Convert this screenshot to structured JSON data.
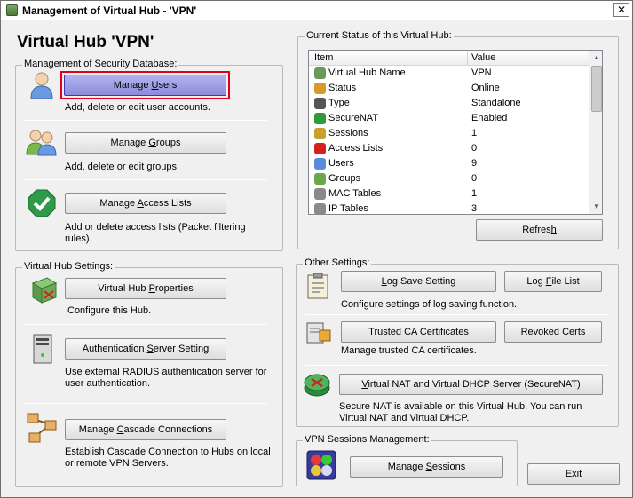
{
  "window": {
    "title": "Management of Virtual Hub - 'VPN'",
    "close_glyph": "✕"
  },
  "heading": "Virtual Hub 'VPN'",
  "security_db": {
    "legend": "Management of Security Database:",
    "manage_users": {
      "pre": "Manage ",
      "key": "U",
      "post": "sers",
      "desc": "Add, delete or edit user accounts.",
      "icon": "user-icon"
    },
    "manage_groups": {
      "pre": "Manage ",
      "key": "G",
      "post": "roups",
      "desc": "Add, delete or edit groups.",
      "icon": "group-icon"
    },
    "manage_access_lists": {
      "pre": "Manage ",
      "key": "A",
      "post": "ccess Lists",
      "desc": "Add or delete access lists (Packet filtering rules).",
      "icon": "checkmark-shield-icon"
    }
  },
  "hub_settings": {
    "legend": "Virtual Hub Settings:",
    "properties": {
      "pre": "Virtual Hub ",
      "key": "P",
      "post": "roperties",
      "desc": "Configure this Hub.",
      "icon": "hub-properties-icon"
    },
    "auth_server": {
      "pre": "Authentication ",
      "key": "S",
      "post": "erver Setting",
      "desc": "Use external RADIUS authentication server for user authentication.",
      "icon": "server-icon"
    },
    "cascade": {
      "pre": "Manage ",
      "key": "C",
      "post": "ascade Connections",
      "desc": "Establish Cascade Connection to Hubs on local or remote VPN Servers.",
      "icon": "cascade-network-icon"
    }
  },
  "status": {
    "legend": "Current Status of this Virtual Hub:",
    "columns": [
      "Item",
      "Value"
    ],
    "rows": [
      {
        "item": "Virtual Hub Name",
        "value": "VPN",
        "icon": "hub-icon",
        "color": "#6a9a5a"
      },
      {
        "item": "Status",
        "value": "Online",
        "icon": "status-icon",
        "color": "#d89a2a"
      },
      {
        "item": "Type",
        "value": "Standalone",
        "icon": "server-icon",
        "color": "#555555"
      },
      {
        "item": "SecureNAT",
        "value": "Enabled",
        "icon": "securenat-icon",
        "color": "#2e9a3a"
      },
      {
        "item": "Sessions",
        "value": "1",
        "icon": "session-icon",
        "color": "#c8a030"
      },
      {
        "item": "Access Lists",
        "value": "0",
        "icon": "no-entry-icon",
        "color": "#d42020"
      },
      {
        "item": "Users",
        "value": "9",
        "icon": "user-icon",
        "color": "#5a8ad8"
      },
      {
        "item": "Groups",
        "value": "0",
        "icon": "group-icon",
        "color": "#6aa84a"
      },
      {
        "item": "MAC Tables",
        "value": "1",
        "icon": "gear-icon",
        "color": "#8a8a8a"
      },
      {
        "item": "IP Tables",
        "value": "3",
        "icon": "gear-icon",
        "color": "#8a8a8a"
      }
    ],
    "refresh": {
      "pre": "Refres",
      "key": "h",
      "post": ""
    },
    "scroll_up": "▲",
    "scroll_down": "▼"
  },
  "other_settings": {
    "legend": "Other Settings:",
    "log_save": {
      "pre": "",
      "key": "L",
      "post": "og Save Setting"
    },
    "log_file_list": {
      "pre": "Log ",
      "key": "F",
      "post": "ile List"
    },
    "log_desc": "Configure settings of log saving function.",
    "trusted_ca": {
      "pre": "",
      "key": "T",
      "post": "rusted CA Certificates"
    },
    "revoked_certs": {
      "pre": "Revo",
      "key": "k",
      "post": "ed Certs"
    },
    "ca_desc": "Manage trusted CA certificates.",
    "securenat": {
      "pre": "",
      "key": "V",
      "post": "irtual NAT and Virtual DHCP Server (SecureNAT)"
    },
    "securenat_desc": "Secure NAT is available on this Virtual Hub. You can run Virtual NAT and Virtual DHCP."
  },
  "sessions": {
    "legend": "VPN Sessions Management:",
    "manage_sessions": {
      "pre": "Manage ",
      "key": "S",
      "post": "essions"
    }
  },
  "exit": {
    "pre": "E",
    "key": "x",
    "post": "it"
  }
}
